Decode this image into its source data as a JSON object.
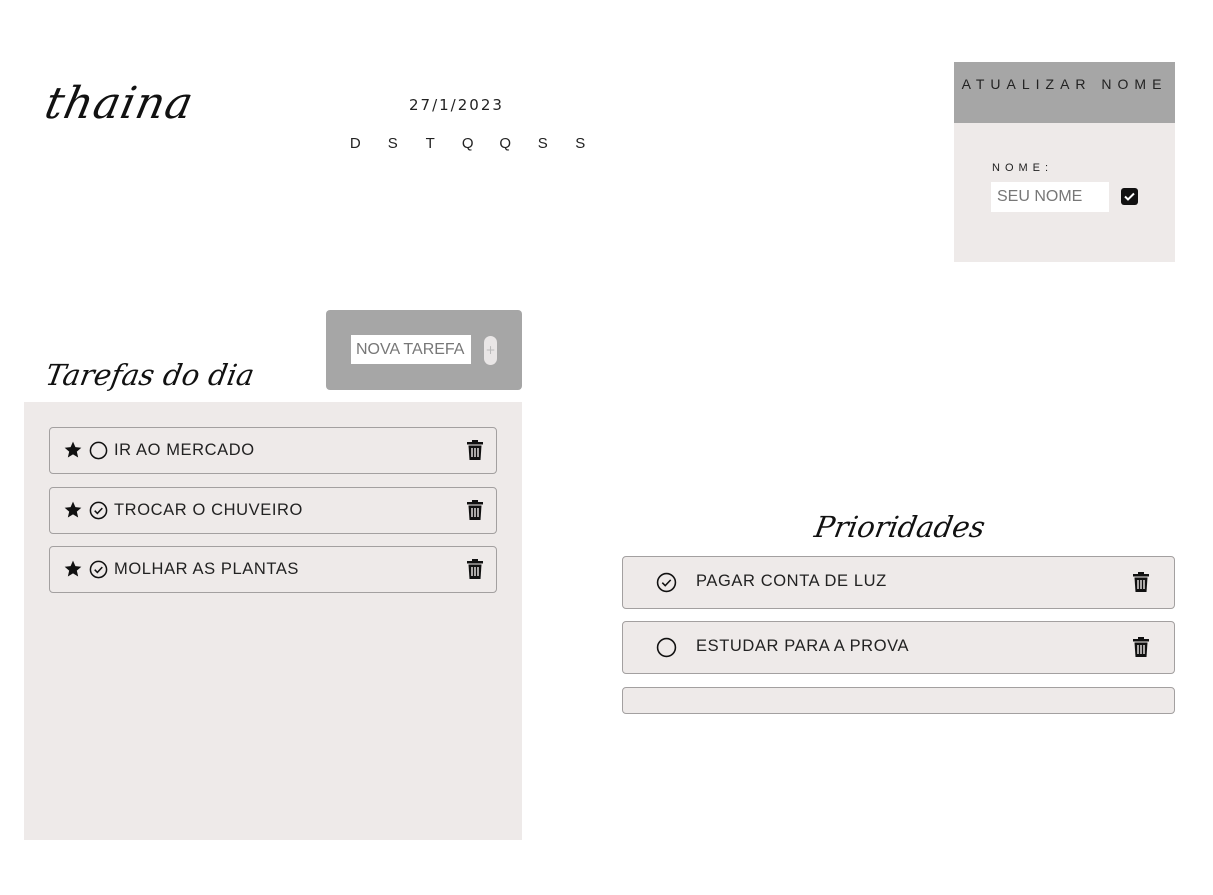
{
  "header": {
    "logo_text": "thaina",
    "date": "27/1/2023",
    "weekdays": [
      "D",
      "S",
      "T",
      "Q",
      "Q",
      "S",
      "S"
    ]
  },
  "name_card": {
    "title": "ATUALIZAR NOME",
    "label": "NOME:",
    "input_placeholder": "SEU NOME"
  },
  "tasks": {
    "title": "Tarefas do dia",
    "new_task_placeholder": "NOVA TAREFA",
    "add_label": "+",
    "items": [
      {
        "label": "IR AO MERCADO",
        "done": false,
        "starred": true
      },
      {
        "label": "TROCAR O CHUVEIRO",
        "done": true,
        "starred": true
      },
      {
        "label": "MOLHAR AS PLANTAS",
        "done": true,
        "starred": true
      }
    ]
  },
  "priorities": {
    "title": "Prioridades",
    "items": [
      {
        "label": "PAGAR CONTA DE LUZ",
        "done": true
      },
      {
        "label": "ESTUDAR PARA A PROVA",
        "done": false
      }
    ]
  },
  "colors": {
    "panel_bg": "#eeeae9",
    "header_gray": "#a6a6a6",
    "border": "#a3a0a0",
    "ink": "#111111"
  }
}
